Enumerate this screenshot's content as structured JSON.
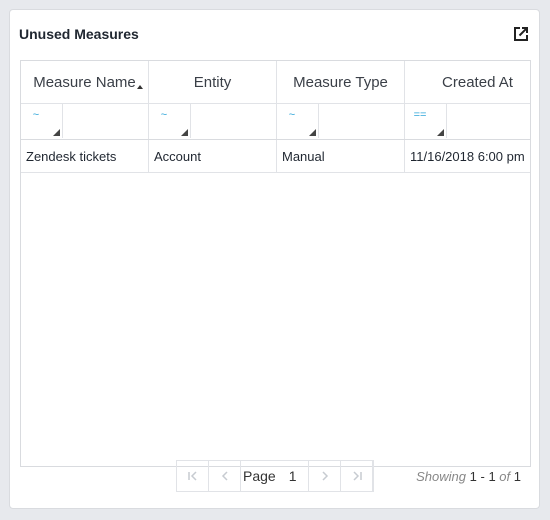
{
  "panel": {
    "title": "Unused Measures",
    "expand_icon": "external-link-icon"
  },
  "grid": {
    "columns": [
      {
        "label": "Measure Name",
        "sorted": "ascending",
        "filter_operator": "~"
      },
      {
        "label": "Entity",
        "filter_operator": "~"
      },
      {
        "label": "Measure Type",
        "filter_operator": "~"
      },
      {
        "label": "Created At",
        "filter_operator": "=="
      }
    ],
    "rows": [
      [
        "Zendesk tickets",
        "Account",
        "Manual",
        "11/16/2018 6:00 pm"
      ]
    ]
  },
  "pagination": {
    "page_label": "Page",
    "current_page": "1",
    "showing_label": "Showing",
    "range_start": "1",
    "range_sep": " - ",
    "range_end": "1",
    "of_label": "of",
    "total": "1",
    "icons": [
      "first-page-icon",
      "previous-page-icon",
      "next-page-icon",
      "last-page-icon"
    ]
  },
  "colors": {
    "accent": "#2ea5d9",
    "border": "#d9dbdf",
    "background": "#e7e9ed"
  }
}
